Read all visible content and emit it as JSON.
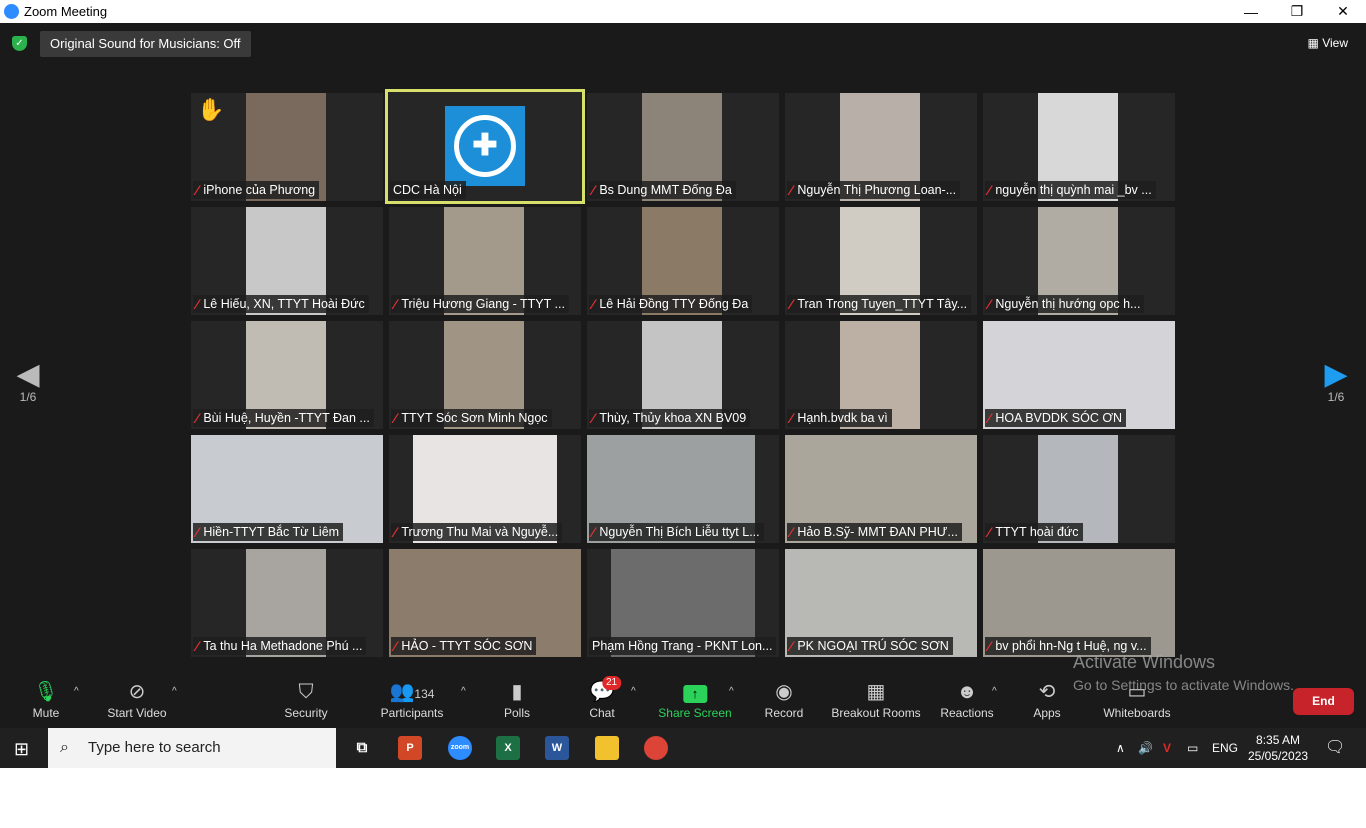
{
  "window": {
    "title": "Zoom Meeting",
    "minimize": "—",
    "maximize": "❐",
    "close": "✕"
  },
  "top": {
    "original_sound": "Original Sound for Musicians: Off",
    "view_label": "View"
  },
  "pagination": {
    "left": "1/6",
    "right": "1/6"
  },
  "colors": {
    "accent_green": "#2bd35a",
    "active_speaker_border": "#d6e06a",
    "muted_red": "#e0312f",
    "end_red": "#c7232a"
  },
  "participants": [
    {
      "name": "iPhone của Phương",
      "muted": true,
      "raised_hand": true
    },
    {
      "name": "CDC Hà Nội",
      "muted": false,
      "active": true
    },
    {
      "name": "Bs Dung MMT Đống Đa",
      "muted": true
    },
    {
      "name": "Nguyễn Thị Phương Loan-...",
      "muted": true
    },
    {
      "name": "nguyễn thị quỳnh mai _bv ...",
      "muted": true
    },
    {
      "name": "Lê Hiếu, XN, TTYT Hoài Đức",
      "muted": true
    },
    {
      "name": "Triệu Hương Giang - TTYT ...",
      "muted": true
    },
    {
      "name": "Lê Hải Đồng TTY Đống Đa",
      "muted": true
    },
    {
      "name": "Tran Trong Tuyen_TTYT Tây...",
      "muted": true
    },
    {
      "name": "Nguyễn thị hướng   opc h...",
      "muted": true
    },
    {
      "name": "Bùi Huệ, Huyền -TTYT Đan ...",
      "muted": true
    },
    {
      "name": "TTYT Sóc Sơn Minh Ngọc",
      "muted": true
    },
    {
      "name": "Thùy, Thủy khoa XN BV09",
      "muted": true
    },
    {
      "name": "Hạnh.bvdk ba vì",
      "muted": true
    },
    {
      "name": "HOA BVDDK SÓC ƠN",
      "muted": true
    },
    {
      "name": "Hiền-TTYT Bắc Từ Liêm",
      "muted": true
    },
    {
      "name": "Trương Thu Mai và Nguyễ...",
      "muted": true
    },
    {
      "name": "Nguyễn Thị Bích Liễu ttyt L...",
      "muted": true
    },
    {
      "name": "Hảo B.Sỹ- MMT ĐAN PHƯ...",
      "muted": true
    },
    {
      "name": "TTYT hoài đức",
      "muted": true
    },
    {
      "name": "Ta thu Ha Methadone Phú ...",
      "muted": true
    },
    {
      "name": "HẢO - TTYT SÓC SƠN",
      "muted": true
    },
    {
      "name": "Phạm Hồng Trang - PKNT Lon...",
      "muted": false
    },
    {
      "name": "PK NGOẠI TRÚ SÓC SƠN",
      "muted": true
    },
    {
      "name": "bv phổi hn-Ng t Huệ, ng v...",
      "muted": true
    }
  ],
  "toolbar": {
    "mute": "Mute",
    "start_video": "Start Video",
    "security": "Security",
    "participants": "Participants",
    "participants_count": "134",
    "polls": "Polls",
    "chat": "Chat",
    "chat_badge": "21",
    "share_screen": "Share Screen",
    "record": "Record",
    "breakout_rooms": "Breakout Rooms",
    "reactions": "Reactions",
    "apps": "Apps",
    "whiteboards": "Whiteboards",
    "end": "End"
  },
  "watermark": {
    "line1": "Activate Windows",
    "line2": "Go to Settings to activate Windows."
  },
  "taskbar": {
    "search_placeholder": "Type here to search",
    "language": "ENG",
    "time": "8:35 AM",
    "date": "25/05/2023"
  }
}
